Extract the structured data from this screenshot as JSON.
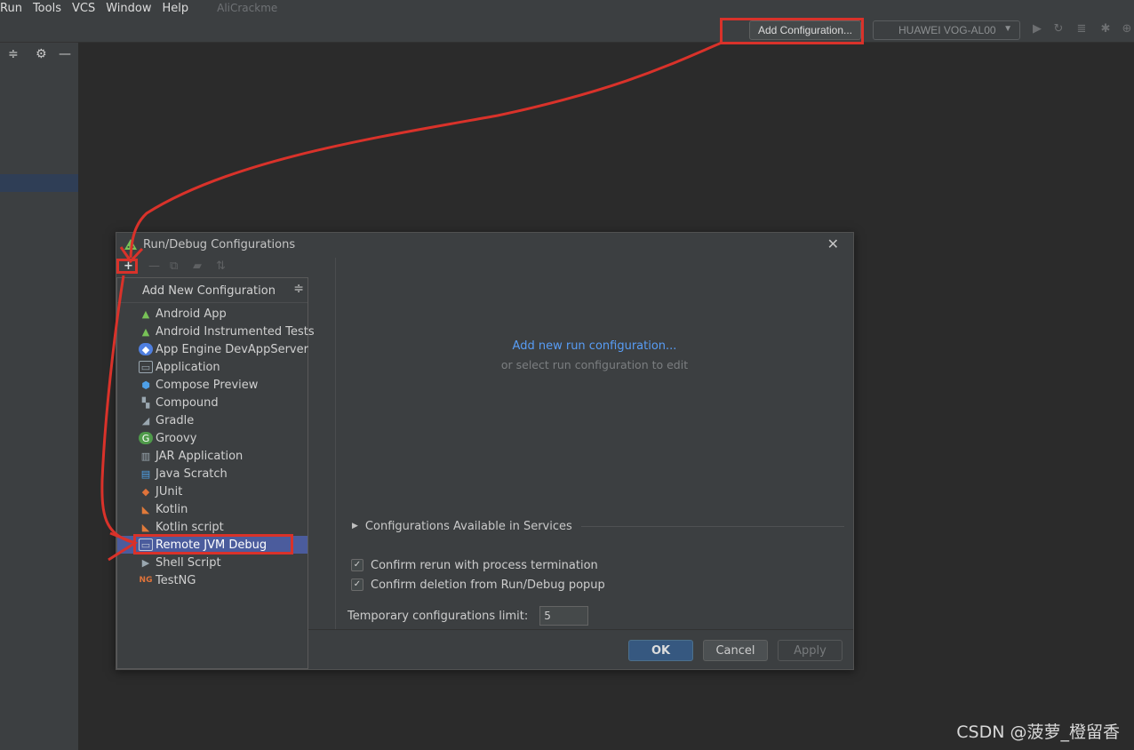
{
  "menubar": {
    "items": [
      "Run",
      "Tools",
      "VCS",
      "Window",
      "Help"
    ],
    "project_name": "AliCrackme"
  },
  "toolbar": {
    "add_configuration_label": "Add Configuration...",
    "device_label": "HUAWEI VOG-AL00",
    "icons": [
      "run-icon",
      "rerun-icon",
      "logcat-icon",
      "debug-icon",
      "attach-icon"
    ]
  },
  "dialog": {
    "title": "Run/Debug Configurations",
    "popup": {
      "header": "Add New Configuration",
      "items": [
        {
          "label": "Android App",
          "icon": "android-icon"
        },
        {
          "label": "Android Instrumented Tests",
          "icon": "android-test-icon"
        },
        {
          "label": "App Engine DevAppServer",
          "icon": "app-engine-icon"
        },
        {
          "label": "Application",
          "icon": "application-icon"
        },
        {
          "label": "Compose Preview",
          "icon": "compose-icon"
        },
        {
          "label": "Compound",
          "icon": "compound-icon"
        },
        {
          "label": "Gradle",
          "icon": "gradle-icon"
        },
        {
          "label": "Groovy",
          "icon": "groovy-icon"
        },
        {
          "label": "JAR Application",
          "icon": "jar-icon"
        },
        {
          "label": "Java Scratch",
          "icon": "java-scratch-icon"
        },
        {
          "label": "JUnit",
          "icon": "junit-icon"
        },
        {
          "label": "Kotlin",
          "icon": "kotlin-icon"
        },
        {
          "label": "Kotlin script",
          "icon": "kotlin-script-icon"
        },
        {
          "label": "Remote JVM Debug",
          "icon": "remote-debug-icon",
          "selected": true
        },
        {
          "label": "Shell Script",
          "icon": "shell-icon"
        },
        {
          "label": "TestNG",
          "icon": "testng-icon"
        }
      ]
    },
    "right": {
      "add_link": "Add new run configuration...",
      "hint": "or select run configuration to edit",
      "services_label": "Configurations Available in Services",
      "checkbox_rerun": "Confirm rerun with process termination",
      "checkbox_delete": "Confirm deletion from Run/Debug popup",
      "limit_label": "Temporary configurations limit:",
      "limit_value": "5"
    },
    "buttons": {
      "ok": "OK",
      "cancel": "Cancel",
      "apply": "Apply"
    }
  },
  "watermark": "CSDN @菠萝_橙留香",
  "colors": {
    "annotation_red": "#d9322a",
    "selection_blue": "#4b5c9d",
    "link_blue": "#589df6"
  }
}
